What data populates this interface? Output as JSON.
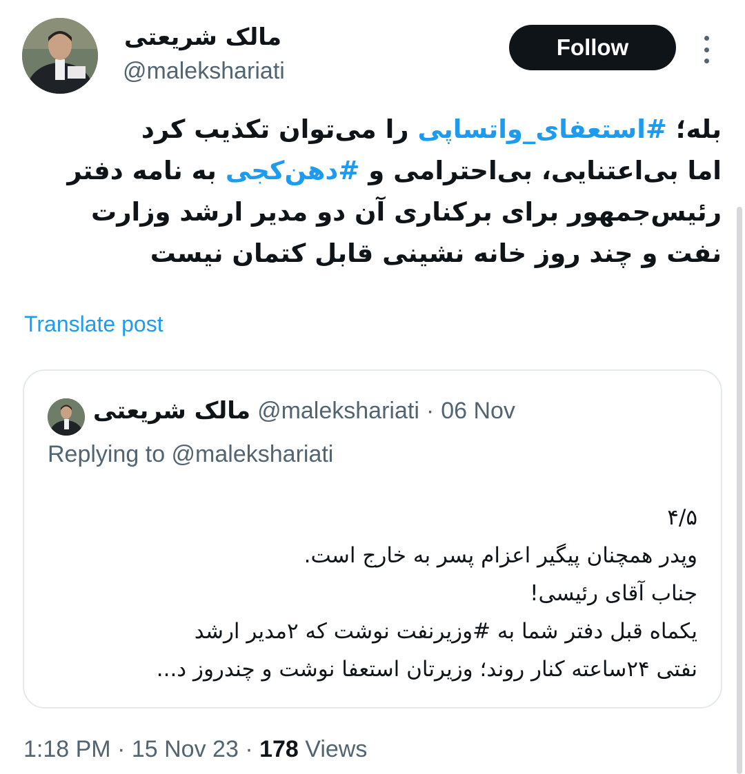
{
  "author": {
    "display_name": "مالک شریعتی",
    "handle": "@malekshariati"
  },
  "follow_label": "Follow",
  "tweet": {
    "lines": [
      [
        {
          "t": "بله؛ "
        },
        {
          "t": "#استعفای_واتساپی",
          "tag": true
        },
        {
          "t": " را می‌توان تکذیب کرد"
        }
      ],
      [
        {
          "t": "اما بی‌اعتنایی، بی‌احترامی و "
        },
        {
          "t": "#دهن‌کجی",
          "tag": true
        },
        {
          "t": " به نامه دفتر"
        }
      ],
      [
        {
          "t": "رئیس‌جمهور برای برکناری آن دو مدیر ارشد وزارت"
        }
      ],
      [
        {
          "t": "نفت و چند روز خانه نشینی قابل کتمان نیست"
        }
      ]
    ]
  },
  "translate_label": "Translate post",
  "quote": {
    "display_name": "مالک شریعتی",
    "handle": "@malekshariati",
    "separator": "·",
    "date": "06 Nov",
    "replying_to": "Replying to @malekshariati",
    "lines": [
      "۴/۵",
      "وپدر همچنان پیگیر اعزام پسر به خارج است.",
      "جناب آقای رئیسی!",
      "یکماه قبل دفتر شما به #وزیرنفت نوشت که ۲مدیر ارشد",
      "نفتی ۲۴ساعته کنار روند؛ وزیرتان استعفا نوشت و چندروز د..."
    ]
  },
  "footer": {
    "time": "1:18 PM",
    "separator": "·",
    "date": "15 Nov 23",
    "views_count": "178",
    "views_label": "Views"
  },
  "colors": {
    "accent": "#1d9bf0",
    "text_primary": "#0f1419",
    "text_secondary": "#536471",
    "button_bg": "#0f1419"
  },
  "icons": {
    "more": "more-vertical-icon"
  }
}
